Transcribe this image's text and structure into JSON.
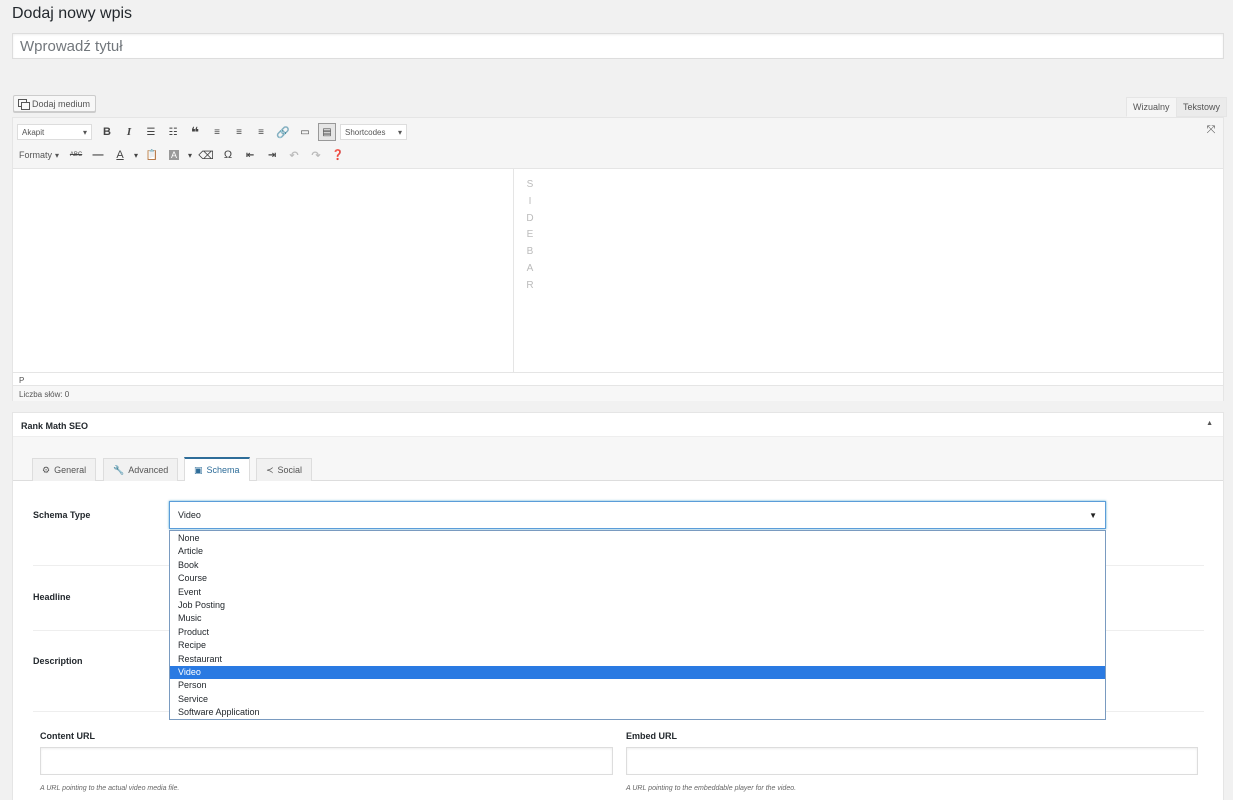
{
  "page": {
    "title": "Dodaj nowy wpis",
    "title_placeholder": "Wprowadź tytuł"
  },
  "editor": {
    "add_media_label": "Dodaj medium",
    "tabs": [
      "Wizualny",
      "Tekstowy"
    ],
    "paragraph_select": "Akapit",
    "shortcodes_select": "Shortcodes",
    "formats_label": "Formaty",
    "sidebar_letters": [
      "S",
      "I",
      "D",
      "E",
      "B",
      "A",
      "R"
    ],
    "path": "P",
    "word_count": "Liczba słów: 0"
  },
  "seo": {
    "title": "Rank Math SEO",
    "tabs": [
      {
        "label": "General",
        "icon": "gear-icon"
      },
      {
        "label": "Advanced",
        "icon": "wrench-icon"
      },
      {
        "label": "Schema",
        "icon": "schema-icon"
      },
      {
        "label": "Social",
        "icon": "share-icon"
      }
    ],
    "schema_type_label": "Schema Type",
    "schema_type_value": "Video",
    "schema_options": [
      "None",
      "Article",
      "Book",
      "Course",
      "Event",
      "Job Posting",
      "Music",
      "Product",
      "Recipe",
      "Restaurant",
      "Video",
      "Person",
      "Service",
      "Software Application"
    ],
    "selected_option": "Video",
    "headline_label": "Headline",
    "description_label": "Description",
    "content_url_label": "Content URL",
    "content_url_help": "A URL pointing to the actual video media file.",
    "embed_url_label": "Embed URL",
    "embed_url_help": "A URL pointing to the embeddable player for the video."
  },
  "colors": {
    "accent": "#2e6d99",
    "selected_option_bg": "#2a7ae2"
  }
}
